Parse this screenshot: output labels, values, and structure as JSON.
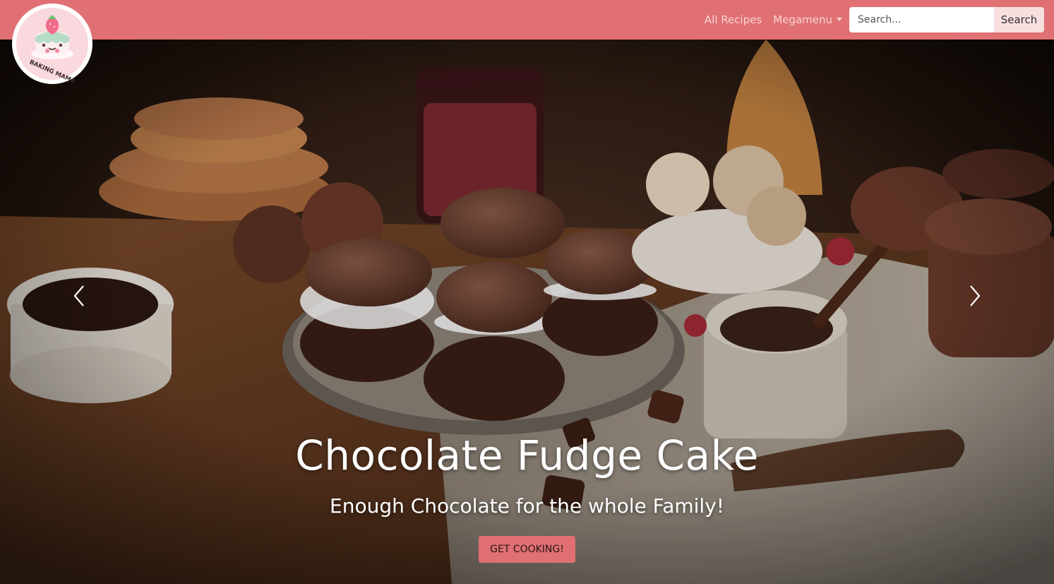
{
  "brand": {
    "logo_text": "BAKING MAMA",
    "colors": {
      "primary": "#e07073",
      "nav_link": "#f7d3d3",
      "button_light": "#f8dede"
    }
  },
  "nav": {
    "links": [
      {
        "label": "All Recipes"
      },
      {
        "label": "Megamenu",
        "icon": "caret-down-icon"
      }
    ]
  },
  "search": {
    "placeholder": "Search...",
    "value": "",
    "button_label": "Search"
  },
  "hero": {
    "title": "Chocolate Fudge Cake",
    "subtitle": "Enough Chocolate for the whole Family!",
    "cta_label": "GET COOKING!",
    "prev_icon": "chevron-left-icon",
    "next_icon": "chevron-right-icon"
  }
}
